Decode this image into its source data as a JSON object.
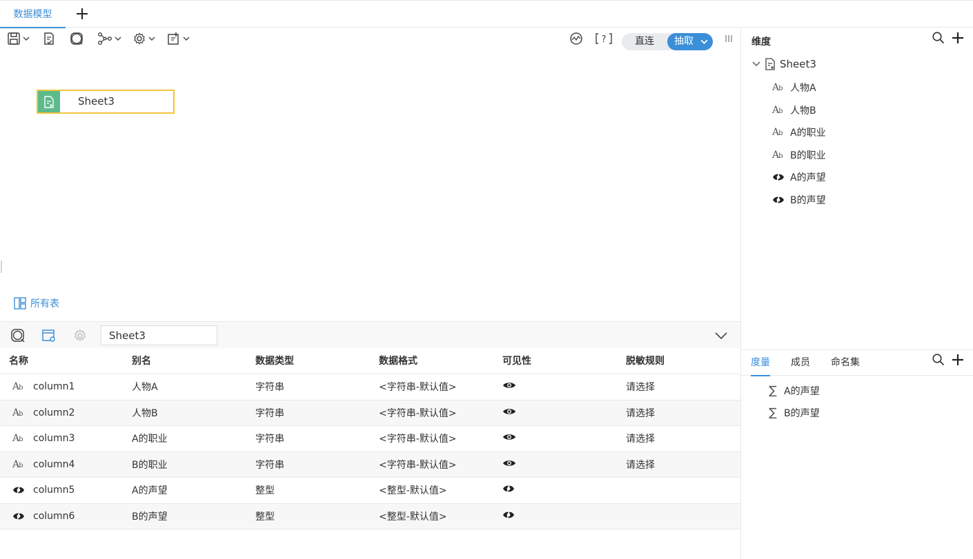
{
  "tabs": {
    "active_tab": "数据模型"
  },
  "mode": {
    "direct": "直连",
    "extract": "抽取"
  },
  "canvas": {
    "table_node": "Sheet3",
    "all_tables": "所有表"
  },
  "bottom": {
    "sheet_value": "Sheet3",
    "headers": [
      "名称",
      "别名",
      "数据类型",
      "数据格式",
      "可见性",
      "脱敏规则"
    ],
    "rows": [
      {
        "name": "column1",
        "alias": "人物A",
        "type": "字符串",
        "format": "<字符串-默认值>",
        "rule": "请选择"
      },
      {
        "name": "column2",
        "alias": "人物B",
        "type": "字符串",
        "format": "<字符串-默认值>",
        "rule": "请选择"
      },
      {
        "name": "column3",
        "alias": "A的职业",
        "type": "字符串",
        "format": "<字符串-默认值>",
        "rule": "请选择"
      },
      {
        "name": "column4",
        "alias": "B的职业",
        "type": "字符串",
        "format": "<字符串-默认值>",
        "rule": "请选择"
      },
      {
        "name": "column5",
        "alias": "A的声望",
        "type": "整型",
        "format": "<整型-默认值>",
        "rule": ""
      },
      {
        "name": "column6",
        "alias": "B的声望",
        "type": "整型",
        "format": "<整型-默认值>",
        "rule": ""
      }
    ]
  },
  "right": {
    "dimension_title": "维度",
    "tree_root": "Sheet3",
    "dimensions": [
      "人物A",
      "人物B",
      "A的职业",
      "B的职业",
      "A的声望",
      "B的声望"
    ],
    "measure_tabs": [
      "度量",
      "成员",
      "命名集"
    ],
    "measures": [
      "A的声望",
      "B的声望"
    ]
  },
  "colors": {
    "accent": "#3b8fd9",
    "node_border": "#f2c43a",
    "node_icon_bg": "#5cba8b"
  }
}
